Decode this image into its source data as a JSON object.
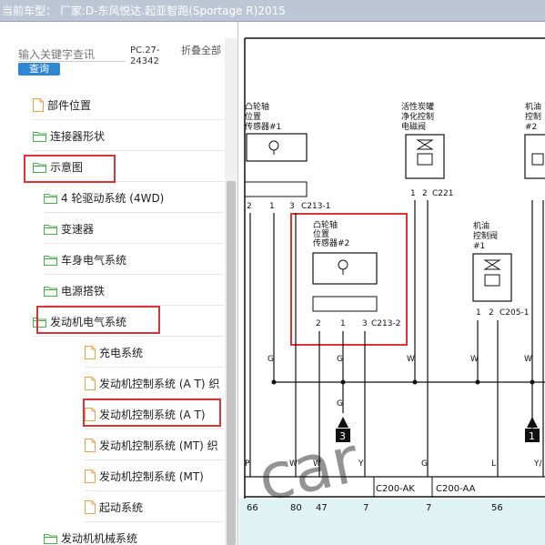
{
  "title_bar": {
    "text": "当前车型： 厂家:D-东风悦达.起亚智跑(Sportage R)2015"
  },
  "sidebar": {
    "search_placeholder": "输入关键字查讯",
    "search_button": "查询",
    "pc_code": "PC.27-24342",
    "collapse_all": "折叠全部",
    "items": [
      {
        "label": "部件位置",
        "type": "file"
      },
      {
        "label": "连接器形状",
        "type": "folder"
      },
      {
        "label": "示意图",
        "type": "folder",
        "open": true,
        "highlighted": true
      },
      {
        "label": "4 轮驱动系统 (4WD)",
        "type": "folder"
      },
      {
        "label": "变速器",
        "type": "folder"
      },
      {
        "label": "车身电气系统",
        "type": "folder"
      },
      {
        "label": "电源搭铁",
        "type": "folder"
      },
      {
        "label": "发动机电气系统",
        "type": "folder",
        "open": true,
        "highlighted": true
      },
      {
        "label": "充电系统",
        "type": "file"
      },
      {
        "label": "发动机控制系统 (A T) 织",
        "type": "file"
      },
      {
        "label": "发动机控制系统 (A T)",
        "type": "file",
        "highlighted": true
      },
      {
        "label": "发动机控制系统 (MT) 织",
        "type": "file"
      },
      {
        "label": "发动机控制系统 (MT)",
        "type": "file"
      },
      {
        "label": "起动系统",
        "type": "file"
      },
      {
        "label": "发动机机械系统",
        "type": "folder"
      }
    ]
  },
  "diagram": {
    "components": {
      "cam1": {
        "line1": "凸轮轴",
        "line2": "位置",
        "line3": "传感器#1",
        "connector": "C213-1",
        "pins": [
          "2",
          "1",
          "3"
        ]
      },
      "canister": {
        "line1": "活性炭罐",
        "line2": "净化控制",
        "line3": "电磁阀",
        "connector": "C221",
        "pins": [
          "1",
          "2"
        ]
      },
      "oil2": {
        "line1": "机油",
        "line2": "控制",
        "line3": "#2"
      },
      "cam2": {
        "line1": "凸轮轴",
        "line2": "位置",
        "line3": "传感器#2",
        "connector": "C213-2",
        "pins": [
          "2",
          "1",
          "3"
        ]
      },
      "oil1": {
        "line1": "机油",
        "line2": "控制阀",
        "line3": "#1",
        "connector": "C205-1",
        "pins": [
          "1",
          "2"
        ]
      }
    },
    "wire_labels": [
      "G",
      "G",
      "W",
      "W",
      "W",
      "G",
      "P",
      "W",
      "W",
      "Y",
      "G",
      "L",
      "Y/"
    ],
    "ground_markers": [
      "3",
      "1"
    ],
    "bottom_connectors": [
      "C200-AK",
      "C200-AA"
    ],
    "bottom_pins": [
      "66",
      "80",
      "47",
      "7",
      "7",
      "56"
    ]
  },
  "colors": {
    "highlight": "#d9343a",
    "search_button": "#2f86d3",
    "folder_green": "#4caf50",
    "file_orange": "#e9a24a",
    "title_bar": "#bcc6d4"
  }
}
